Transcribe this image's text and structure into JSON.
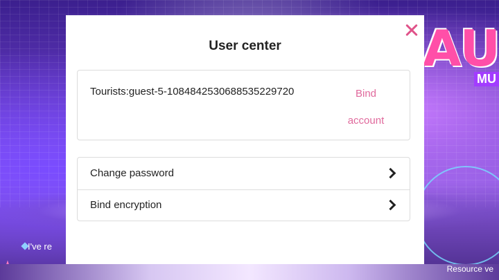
{
  "background": {
    "logo_text": "AU",
    "logo_sub": "MU",
    "side_text": "I've re",
    "resource_text": "Resource ve"
  },
  "modal": {
    "title": "User center",
    "close_icon": "close-icon",
    "account": {
      "label": "Tourists:guest-5-1084842530688535229720",
      "bind_button_line1": "Bind",
      "bind_button_line2": "account"
    },
    "menu": [
      {
        "label": "Change password",
        "icon": "chevron-right-icon"
      },
      {
        "label": "Bind encryption",
        "icon": "chevron-right-icon"
      }
    ]
  },
  "colors": {
    "accent_pink": "#e0699c",
    "close_pink": "#e0538a",
    "text": "#222222",
    "border": "#dcdcdc"
  }
}
